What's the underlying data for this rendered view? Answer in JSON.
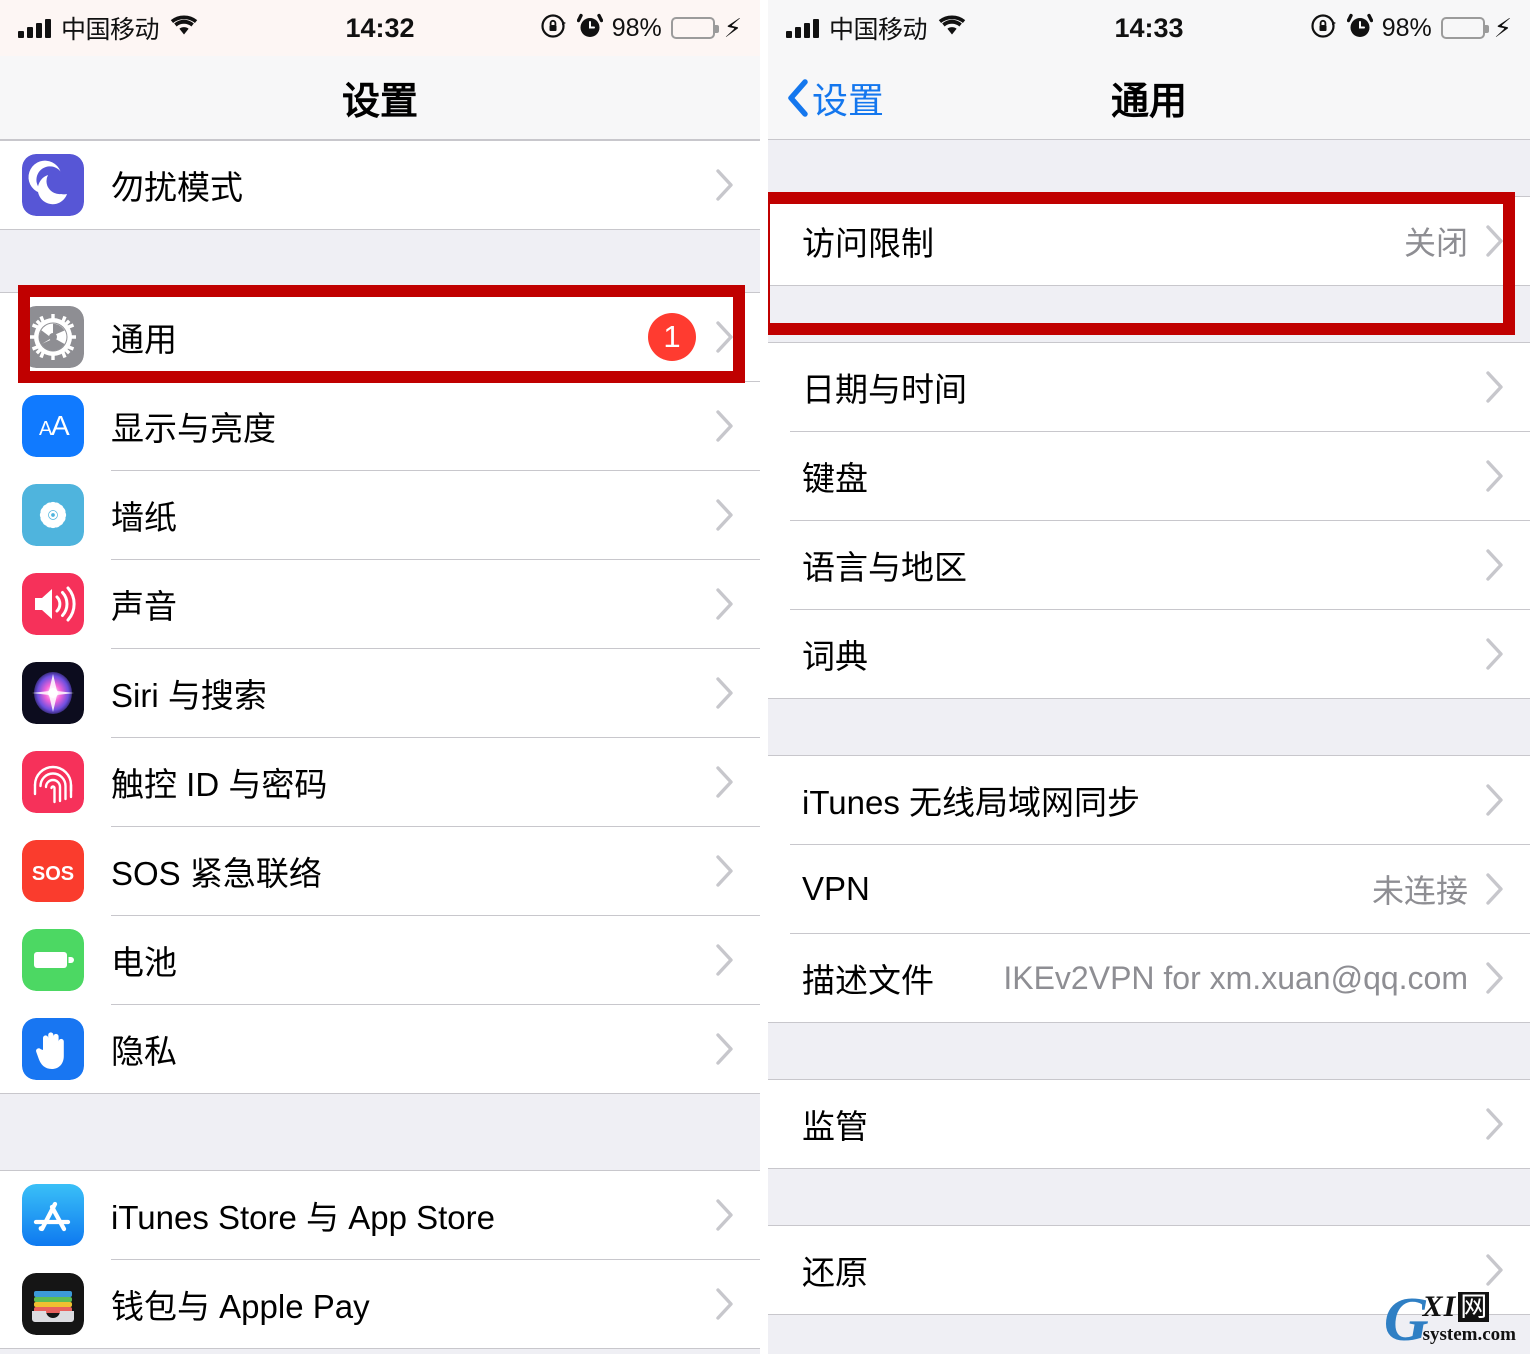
{
  "left": {
    "status": {
      "carrier": "中国移动",
      "time": "14:32",
      "battery_pct": "98%",
      "signal_icon": "signal-bars-icon",
      "wifi_icon": "wifi-icon",
      "rotation_lock_icon": "rotation-lock-icon",
      "alarm_icon": "alarm-clock-icon",
      "battery_icon": "battery-icon",
      "charging_icon": "lightning-bolt-icon"
    },
    "nav": {
      "title": "设置"
    },
    "groups": [
      {
        "rows": [
          {
            "icon": "moon-icon",
            "label": "勿扰模式",
            "value": "",
            "badge": ""
          }
        ]
      },
      {
        "rows": [
          {
            "icon": "gear-icon",
            "label": "通用",
            "value": "",
            "badge": "1"
          },
          {
            "icon": "display-aa-icon",
            "label": "显示与亮度",
            "value": "",
            "badge": ""
          },
          {
            "icon": "wallpaper-icon",
            "label": "墙纸",
            "value": "",
            "badge": ""
          },
          {
            "icon": "sound-icon",
            "label": "声音",
            "value": "",
            "badge": ""
          },
          {
            "icon": "siri-icon",
            "label": "Siri 与搜索",
            "value": "",
            "badge": ""
          },
          {
            "icon": "touchid-icon",
            "label": "触控 ID 与密码",
            "value": "",
            "badge": ""
          },
          {
            "icon": "sos-icon",
            "label": "SOS 紧急联络",
            "value": "",
            "badge": ""
          },
          {
            "icon": "battery-icon",
            "label": "电池",
            "value": "",
            "badge": ""
          },
          {
            "icon": "privacy-hand-icon",
            "label": "隐私",
            "value": "",
            "badge": ""
          }
        ]
      },
      {
        "rows": [
          {
            "icon": "appstore-icon",
            "label": "iTunes Store 与 App Store",
            "value": "",
            "badge": ""
          },
          {
            "icon": "wallet-icon",
            "label": "钱包与 Apple Pay",
            "value": "",
            "badge": ""
          }
        ]
      }
    ]
  },
  "right": {
    "status": {
      "carrier": "中国移动",
      "time": "14:33",
      "battery_pct": "98%",
      "signal_icon": "signal-bars-icon",
      "wifi_icon": "wifi-icon",
      "rotation_lock_icon": "rotation-lock-icon",
      "alarm_icon": "alarm-clock-icon",
      "battery_icon": "battery-icon",
      "charging_icon": "lightning-bolt-icon"
    },
    "nav": {
      "back_label": "设置",
      "title": "通用",
      "back_icon": "chevron-left-icon"
    },
    "groups": [
      {
        "rows": [
          {
            "label": "访问限制",
            "value": "关闭"
          }
        ]
      },
      {
        "rows": [
          {
            "label": "日期与时间",
            "value": ""
          },
          {
            "label": "键盘",
            "value": ""
          },
          {
            "label": "语言与地区",
            "value": ""
          },
          {
            "label": "词典",
            "value": ""
          }
        ]
      },
      {
        "rows": [
          {
            "label": "iTunes 无线局域网同步",
            "value": ""
          },
          {
            "label": "VPN",
            "value": "未连接"
          },
          {
            "label": "描述文件",
            "value": "IKEv2VPN for xm.xuan@qq.com"
          }
        ]
      },
      {
        "rows": [
          {
            "label": "监管",
            "value": ""
          }
        ]
      },
      {
        "rows": [
          {
            "label": "还原",
            "value": ""
          }
        ]
      }
    ]
  },
  "watermark": {
    "g": "G",
    "xi": "XI",
    "wang": "网",
    "domain": "system.com"
  },
  "colors": {
    "highlight_box": "#c00000",
    "badge_red": "#ff3b30",
    "link_blue": "#1477ee",
    "value_gray": "#8e8e93",
    "group_bg": "#efeff4"
  }
}
